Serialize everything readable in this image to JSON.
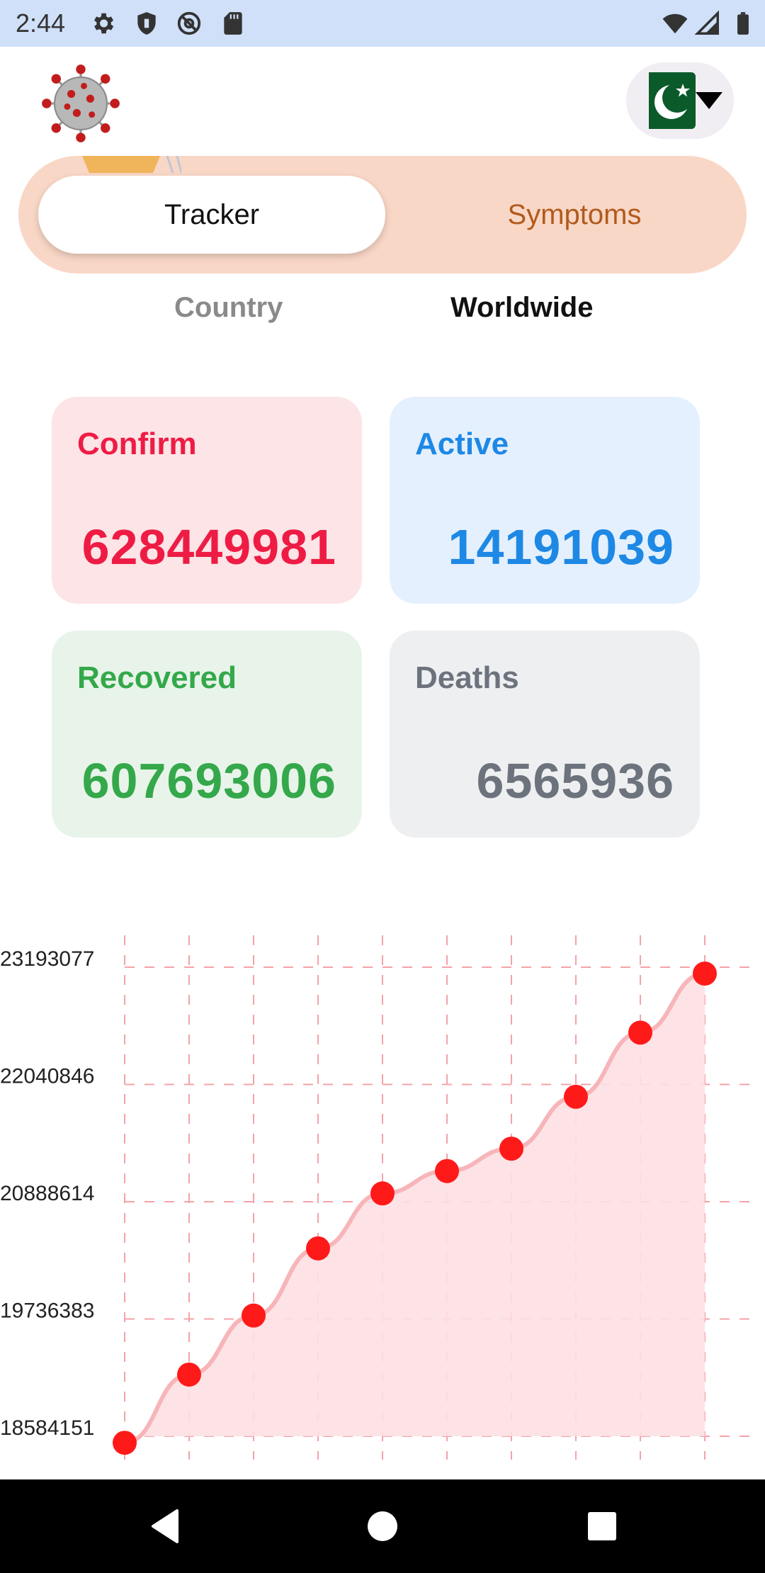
{
  "status_bar": {
    "time": "2:44",
    "left_icons": [
      "gear-icon",
      "shield-icon",
      "at-sign-icon",
      "sd-card-icon"
    ],
    "right_icons": [
      "wifi-icon",
      "signal-icon",
      "battery-icon"
    ]
  },
  "header": {
    "logo_icon": "virus-icon",
    "country_selector": {
      "flag": "pakistan-flag-icon",
      "dropdown_icon": "caret-down-icon"
    }
  },
  "tabs": {
    "tracker_label": "Tracker",
    "symptoms_label": "Symptoms",
    "active": "Tracker"
  },
  "subtabs": {
    "country_label": "Country",
    "worldwide_label": "Worldwide",
    "active": "Worldwide"
  },
  "stats": {
    "confirm": {
      "label": "Confirm",
      "value": "628449981"
    },
    "active": {
      "label": "Active",
      "value": "14191039"
    },
    "recovered": {
      "label": "Recovered",
      "value": "607693006"
    },
    "deaths": {
      "label": "Deaths",
      "value": "6565936"
    }
  },
  "colors": {
    "confirm": "#ee1c45",
    "active": "#1e88e5",
    "recovered": "#34a84a",
    "deaths": "#6c737d",
    "tab_bg": "#f9d7c6",
    "symptoms_text": "#b15a1c",
    "status_bar": "#cfe0f8",
    "chart_point": "#ff1a1a",
    "chart_fill": "#fde0e3",
    "chart_line": "#f7b5b9",
    "chart_grid": "#f4a3a8"
  },
  "chart_data": {
    "type": "area",
    "y_ticks": [
      "18584151",
      "19736383",
      "20888614",
      "22040846",
      "23193077"
    ],
    "ylim": [
      18584151,
      23193077
    ],
    "x": [
      1,
      2,
      3,
      4,
      5,
      6,
      7,
      8,
      9,
      10
    ],
    "series": [
      {
        "values": [
          18520000,
          19190000,
          19770000,
          20430000,
          20970000,
          21190000,
          21410000,
          21920000,
          22550000,
          23130000
        ]
      }
    ],
    "grid": true,
    "grid_style": "dashed",
    "markers": true
  },
  "nav_bar": {
    "back_icon": "back-triangle-icon",
    "home_icon": "home-circle-icon",
    "recents_icon": "recents-square-icon"
  }
}
